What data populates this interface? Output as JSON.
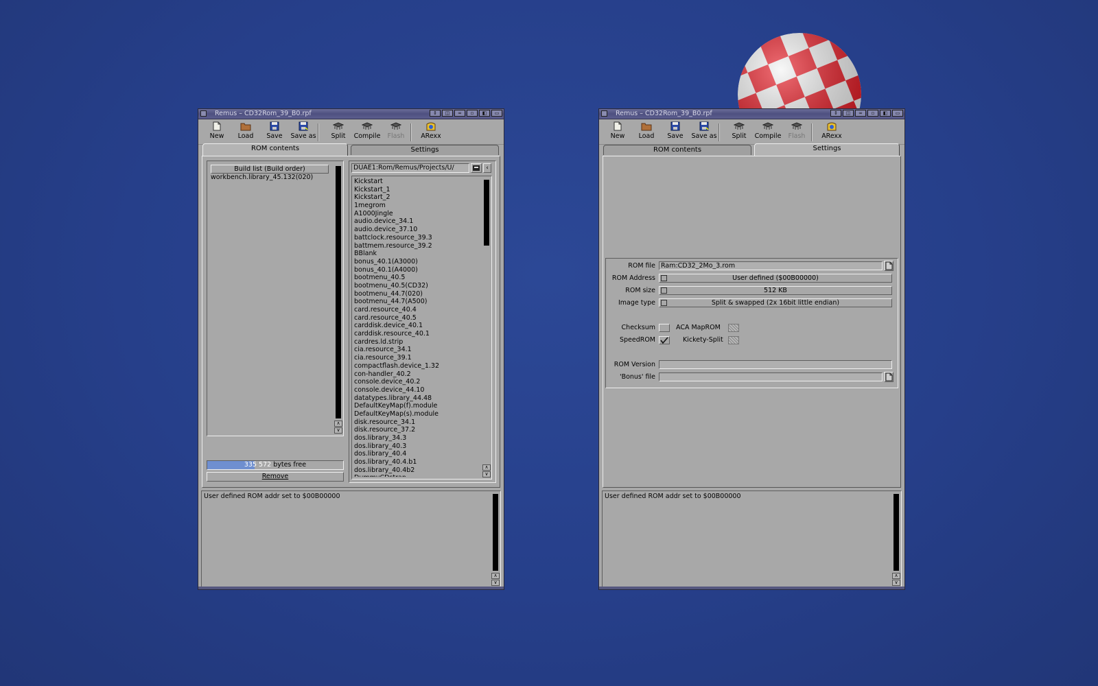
{
  "window_title": "Remus – CD32Rom_39_B0.rpf",
  "toolbar": [
    {
      "label": "New",
      "icon": "new-page-icon",
      "disabled": false
    },
    {
      "label": "Load",
      "icon": "folder-icon",
      "disabled": false
    },
    {
      "label": "Save",
      "icon": "disk-icon",
      "disabled": false
    },
    {
      "label": "Save as",
      "icon": "disk-as-icon",
      "disabled": false
    },
    {
      "label": "Split",
      "icon": "chip-split-icon",
      "disabled": false
    },
    {
      "label": "Compile",
      "icon": "chip-compile-icon",
      "disabled": false
    },
    {
      "label": "Flash",
      "icon": "chip-flash-icon",
      "disabled": true
    },
    {
      "label": "ARexx",
      "icon": "arexx-icon",
      "disabled": false
    }
  ],
  "tabs": [
    "ROM contents",
    "Settings"
  ],
  "left_window": {
    "active_tab": 0,
    "build_list": {
      "header": "Build list (Build order)",
      "items": [
        "workbench.library_45.132(020)"
      ],
      "bytes_free_num": "335 572",
      "bytes_free_suffix": " bytes free",
      "remove_label": "Remove"
    },
    "path_value": "DUAE1:Rom/Remus/Projects/U/",
    "modules": [
      "Kickstart",
      "Kickstart_1",
      "Kickstart_2",
      "1megrom",
      "A1000Jingle",
      "audio.device_34.1",
      "audio.device_37.10",
      "battclock.resource_39.3",
      "battmem.resource_39.2",
      "BBlank",
      "bonus_40.1(A3000)",
      "bonus_40.1(A4000)",
      "bootmenu_40.5",
      "bootmenu_40.5(CD32)",
      "bootmenu_44.7(020)",
      "bootmenu_44.7(A500)",
      "card.resource_40.4",
      "card.resource_40.5",
      "carddisk.device_40.1",
      "carddisk.resource_40.1",
      "cardres.ld.strip",
      "cia.resource_34.1",
      "cia.resource_39.1",
      "compactflash.device_1.32",
      "con-handler_40.2",
      "console.device_40.2",
      "console.device_44.10",
      "datatypes.library_44.48",
      "DefaultKeyMap(f).module",
      "DefaultKeyMap(s).module",
      "disk.resource_34.1",
      "disk.resource_37.2",
      "dos.library_34.3",
      "dos.library_40.3",
      "dos.library_40.4",
      "dos.library_40.4.b1",
      "dos.library_40.4b2",
      "DummyCDstrap"
    ],
    "status_message": "User defined ROM addr set to $00B00000"
  },
  "right_window": {
    "active_tab": 1,
    "settings": {
      "rom_file_label": "ROM file",
      "rom_file_value": "Ram:CD32_2Mo_3.rom",
      "rom_address_label": "ROM Address",
      "rom_address_value": "User defined ($00B00000)",
      "rom_size_label": "ROM size",
      "rom_size_value": "512 KB",
      "image_type_label": "Image type",
      "image_type_value": "Split & swapped (2x 16bit little endian)",
      "checksum_label": "Checksum",
      "checksum_checked": false,
      "aca_label": "ACA MapROM",
      "speedrom_label": "SpeedROM",
      "speedrom_checked": true,
      "kickety_label": "Kickety-Split",
      "rom_version_label": "ROM Version",
      "rom_version_value": "",
      "bonus_label": "'Bonus' file",
      "bonus_value": ""
    },
    "status_message": "User defined ROM addr set to $00B00000"
  },
  "colors": {
    "desktop": "#263f8a",
    "window_gray": "#a8a8a8",
    "titlebar": "#5a5c8c",
    "progress_fill": "#6f8fd0",
    "ball_red": "#e8202a"
  },
  "bytes_used_fraction": 0.35
}
